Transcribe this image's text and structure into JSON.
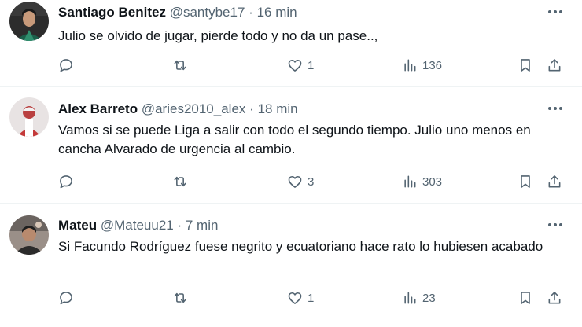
{
  "tweets": [
    {
      "name": "Santiago Benitez",
      "handle": "@santybe17",
      "dot": "·",
      "time": "16 min",
      "text": "Julio se olvido de jugar, pierde todo y no da un pase..,",
      "likes": "1",
      "views": "136"
    },
    {
      "name": "Alex Barreto",
      "handle": "@aries2010_alex",
      "dot": "·",
      "time": "18 min",
      "text": "Vamos si se puede Liga a salir con todo el segundo tiempo. Julio uno menos en cancha Alvarado de urgencia al cambio.",
      "likes": "3",
      "views": "303"
    },
    {
      "name": "Mateu",
      "handle": "@Mateuu21",
      "dot": "·",
      "time": "7 min",
      "text": "Si Facundo Rodríguez fuese negrito y ecuatoriano hace rato lo hubiesen acabado",
      "likes": "1",
      "views": "23"
    }
  ],
  "icons": {
    "reply": "reply-icon",
    "retweet": "retweet-icon",
    "like": "heart-icon",
    "views": "views-icon",
    "bookmark": "bookmark-icon",
    "share": "share-icon",
    "more": "more-icon"
  },
  "colors": {
    "text": "#0f1419",
    "secondary": "#536471",
    "divider": "#eff3f4"
  }
}
